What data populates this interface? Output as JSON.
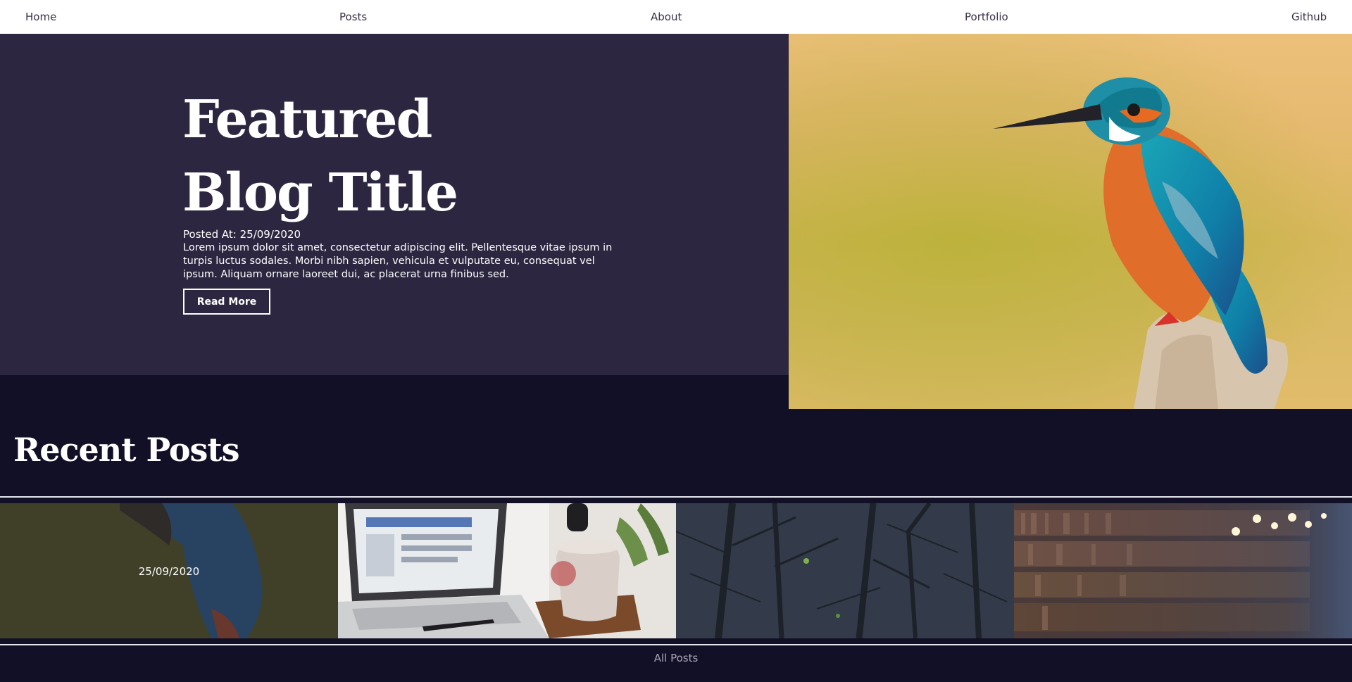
{
  "nav": {
    "home": "Home",
    "posts": "Posts",
    "about": "About",
    "portfolio": "Portfolio",
    "github": "Github"
  },
  "featured": {
    "title": "Featured Blog Title",
    "posted": "Posted At: 25/09/2020",
    "excerpt": "Lorem ipsum dolor sit amet, consectetur adipiscing elit. Pellentesque vitae ipsum in turpis luctus sodales. Morbi nibh sapien, vehicula et vulputate eu, consequat vel ipsum. Aliquam ornare laoreet dui, ac placerat urna finibus sed.",
    "button": "Read More",
    "image": "kingfisher-photo"
  },
  "recent": {
    "title": "Recent Posts",
    "cards": [
      {
        "image": "kingfisher-photo",
        "date": "25/09/2020"
      },
      {
        "image": "laptop-desk-photo"
      },
      {
        "image": "forest-branches-photo"
      },
      {
        "image": "library-bookshelf-photo"
      }
    ],
    "all_posts": "All Posts"
  },
  "colors": {
    "hero_bg": "#2c2640",
    "page_bg": "#121026",
    "nav_bg": "#ffffff"
  }
}
